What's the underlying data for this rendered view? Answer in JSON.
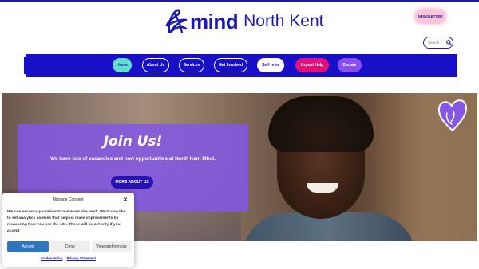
{
  "header": {
    "logo_mind": "mind",
    "logo_location": "North Kent",
    "newsletter_label": "NEWSLETTER",
    "search_placeholder": "Search"
  },
  "nav": {
    "items": [
      {
        "label": "Home",
        "bg": "#5ee0c8",
        "fg": "#1a1ab2"
      },
      {
        "label": "About Us",
        "bg": "#1a0fc8",
        "fg": "#ffffff"
      },
      {
        "label": "Services",
        "bg": "#1a0fc8",
        "fg": "#ffffff"
      },
      {
        "label": "Get Involved",
        "bg": "#1a0fc8",
        "fg": "#ffffff"
      },
      {
        "label": "Self refer",
        "bg": "#ffffff",
        "fg": "#1a1ab2"
      },
      {
        "label": "Urgent Help",
        "bg": "#e0127a",
        "fg": "#ffffff"
      },
      {
        "label": "Donate",
        "bg": "#8a4cf0",
        "fg": "#ffffff"
      }
    ]
  },
  "hero": {
    "title": "Join Us!",
    "text": "We have lots of vacancies and new opportunities at North Kent Mind.",
    "button_label": "MORE ABOUT US"
  },
  "cookie": {
    "title": "Manage Consent",
    "text": "We use necessary cookies to make our site work. We'd also like to set analytics cookies that help us make improvements by measuring how you use the site. These will be set only if you accept",
    "accept_label": "Accept",
    "deny_label": "Deny",
    "prefs_label": "View preferences",
    "link_policy": "Cookie Policy",
    "link_privacy": "Privacy Statement"
  },
  "colors": {
    "brand_blue": "#1a1ab2",
    "nav_blue": "#1a0fc8",
    "accent_purple": "#8458e2",
    "accept_blue": "#2f76c2"
  }
}
